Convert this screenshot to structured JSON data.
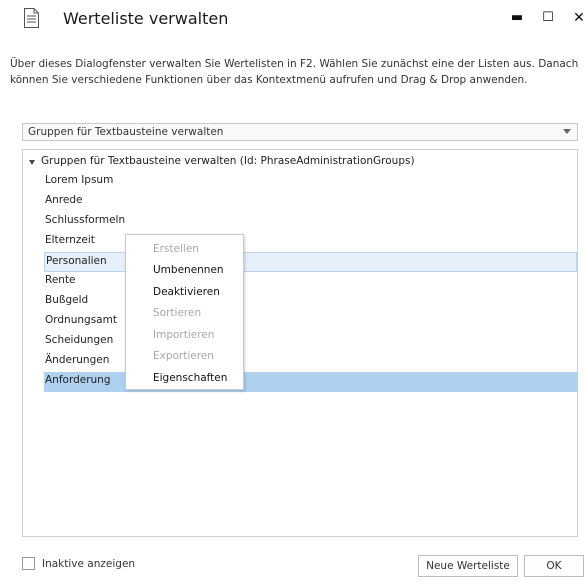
{
  "window": {
    "title": "Werteliste verwalten",
    "controls": {
      "minimize": "▬",
      "maximize": "☐",
      "close": "✕"
    }
  },
  "description": {
    "line1": "Über dieses Dialogfenster verwalten Sie Wertelisten in F2. Wählen Sie zunächst eine der Listen aus. Danach",
    "line2": "können Sie verschiedene Funktionen über das Kontextmenü aufrufen und Drag & Drop anwenden."
  },
  "list_select": {
    "selected": "Gruppen für Textbausteine verwalten"
  },
  "tree": {
    "root_label": "Gruppen für Textbausteine verwalten (Id: PhraseAdministrationGroups)",
    "items": [
      "Lorem Ipsum",
      "Anrede",
      "Schlussformeln",
      "Elternzeit",
      "Personalien",
      "Rente",
      "Bußgeld",
      "Ordnungsamt",
      "Scheidungen",
      "Änderungen",
      "Anforderung"
    ],
    "highlighted_item": "Personalien",
    "selected_item": "Anforderung"
  },
  "context_menu": {
    "items": [
      {
        "label": "Erstellen",
        "enabled": false
      },
      {
        "label": "Umbenennen",
        "enabled": true
      },
      {
        "label": "Deaktivieren",
        "enabled": true
      },
      {
        "label": "Sortieren",
        "enabled": false
      },
      {
        "label": "Importieren",
        "enabled": false
      },
      {
        "label": "Exportieren",
        "enabled": false
      },
      {
        "label": "Eigenschaften",
        "enabled": true
      }
    ]
  },
  "footer": {
    "show_inactive_label": "Inaktive anzeigen",
    "show_inactive_checked": false,
    "new_list_button": "Neue Werteliste",
    "ok_button": "OK"
  },
  "colors": {
    "selected_row": "#aed1f0",
    "highlight_row": "#e6f0fa"
  },
  "icons": {
    "app": "document-list-icon",
    "combo": "chevron-down-icon",
    "tree": "expand-triangle-icon"
  }
}
